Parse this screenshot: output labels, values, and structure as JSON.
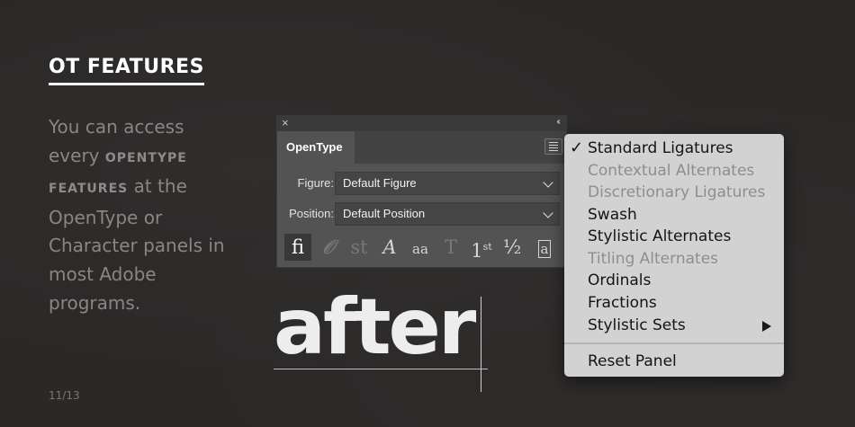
{
  "slide": {
    "heading": "OT FEATURES",
    "body_1": "You can access every",
    "body_strong_1": "OPENTYPE",
    "body_strong_2": "FEATURES",
    "body_2": "at the OpenType or Character panels in most Adobe programs.",
    "page_number": "11/13"
  },
  "panel": {
    "close_icon": "×",
    "collapse_icon": "‹‹",
    "tab": "OpenType",
    "figure_label": "Figure:",
    "figure_value": "Default Figure",
    "position_label": "Position:",
    "position_value": "Default Position",
    "icons": [
      "ligature-icon",
      "contextual-alternates-icon",
      "discretionary-ligature-icon",
      "swash-icon",
      "stylistic-alternates-icon",
      "titling-alternates-icon",
      "ordinals-icon",
      "fractions-icon",
      "stylistic-sets-icon"
    ]
  },
  "demo": {
    "word": "after"
  },
  "menu": {
    "check": "✓",
    "items": [
      {
        "label": "Standard Ligatures",
        "checked": true,
        "enabled": true
      },
      {
        "label": "Contextual Alternates",
        "enabled": false
      },
      {
        "label": "Discretionary Ligatures",
        "enabled": false
      },
      {
        "label": "Swash",
        "enabled": true
      },
      {
        "label": "Stylistic Alternates",
        "enabled": true
      },
      {
        "label": "Titling Alternates",
        "enabled": false
      },
      {
        "label": "Ordinals",
        "enabled": true
      },
      {
        "label": "Fractions",
        "enabled": true
      },
      {
        "label": "Stylistic Sets",
        "enabled": true,
        "submenu": true
      }
    ],
    "reset": "Reset Panel"
  },
  "colors": {
    "background": "#2b2828",
    "panel": "#535353",
    "menu": "#d2d2d2",
    "disabled_text": "#8e8e8e"
  }
}
